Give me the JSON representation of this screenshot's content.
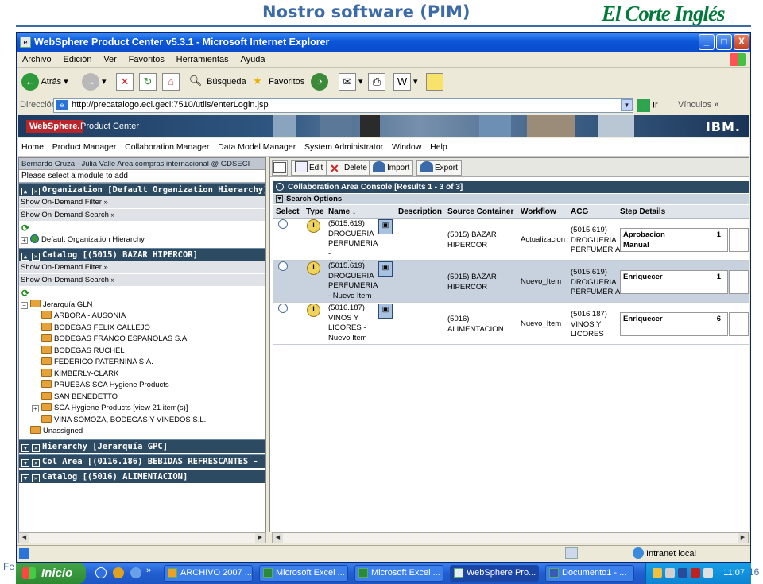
{
  "slide": {
    "title": "Nostro software (PIM)",
    "logo_text": "El Corte Inglés",
    "footer_left": "Fe",
    "page_number": "16"
  },
  "window": {
    "title": "WebSphere Product Center v5.3.1 - Microsoft Internet Explorer",
    "minimize": "_",
    "maximize": "□",
    "close": "X"
  },
  "ie_menu": [
    "Archivo",
    "Edición",
    "Ver",
    "Favoritos",
    "Herramientas",
    "Ayuda"
  ],
  "ie_toolbar": {
    "back": "Atrás",
    "search": "Búsqueda",
    "favorites": "Favoritos"
  },
  "address": {
    "label": "Dirección",
    "url": "http://precatalogo.eci.geci:7510/utils/enterLogin.jsp",
    "go": "Ir",
    "links": "Vínculos"
  },
  "banner": {
    "brand": "WebSphere.",
    "product": "Product Center",
    "vendor": "IBM."
  },
  "app_menu": [
    "Home",
    "Product Manager",
    "Collaboration Manager",
    "Data Model Manager",
    "System Administrator",
    "Window",
    "Help"
  ],
  "left": {
    "user_line": "Bernardo Cruza - Julia Valle Area compras internacional @ GDSECI",
    "module_select": "Please select a module to add",
    "org_section": "Organization [Default Organization Hierarchy]",
    "ondemand_filter": "Show On-Demand Filter »",
    "ondemand_search": "Show On-Demand Search »",
    "org_tree_root": "Default Organization Hierarchy",
    "catalog_section": "Catalog [(5015) BAZAR HIPERCOR]",
    "tree_root": "Jerarquía GLN",
    "tree_items": [
      "ARBORA - AUSONIA",
      "BODEGAS FELIX CALLEJO",
      "BODEGAS FRANCO ESPAÑOLAS S.A.",
      "BODEGAS RUCHEL",
      "FEDERICO PATERNINA S.A.",
      "KIMBERLY-CLARK",
      "PRUEBAS SCA Hygiene Products",
      "SAN BENEDETTO",
      "SCA Hygiene Products [view 21 item(s)]",
      "VIÑA SOMOZA, BODEGAS Y VIÑEDOS S.L."
    ],
    "unassigned": "Unassigned",
    "collapsed_sections": [
      "Hierarchy [Jerarquía GPC]",
      "Col Area [(0116.186) BEBIDAS REFRESCANTES -",
      "Catalog [(5016) ALIMENTACION]"
    ]
  },
  "actions": {
    "edit": "Edit",
    "delete": "Delete",
    "import": "Import",
    "export": "Export"
  },
  "console": {
    "title": "Collaboration Area Console [Results 1 - 3 of 3]",
    "search_options": "Search Options",
    "columns": {
      "select": "Select",
      "type": "Type",
      "name": "Name",
      "description": "Description",
      "source": "Source Container",
      "workflow": "Workflow",
      "acg": "ACG",
      "step": "Step Details"
    },
    "rows": [
      {
        "name": [
          "(5015.619)",
          "DROGUERIA",
          "PERFUMERIA",
          "-",
          "Actualizacion"
        ],
        "source": [
          "(5015) BAZAR",
          "HIPERCOR"
        ],
        "workflow": "Actualizacion",
        "acg": [
          "(5015.619)",
          "DROGUERIA",
          "PERFUMERIA"
        ],
        "step": [
          "Aprobacion",
          "Manual"
        ],
        "count": "1"
      },
      {
        "name": [
          "(5015.619)",
          "DROGUERIA",
          "PERFUMERIA",
          "- Nuevo Item"
        ],
        "source": [
          "(5015) BAZAR",
          "HIPERCOR"
        ],
        "workflow": "Nuevo_Item",
        "acg": [
          "(5015.619)",
          "DROGUERIA",
          "PERFUMERIA"
        ],
        "step": [
          "Enriquecer"
        ],
        "count": "1"
      },
      {
        "name": [
          "(5016.187)",
          "VINOS Y",
          "LICORES -",
          "Nuevo Item"
        ],
        "source": [
          "(5016)",
          "ALIMENTACION"
        ],
        "workflow": "Nuevo_Item",
        "acg": [
          "(5016.187)",
          "VINOS Y",
          "LICORES"
        ],
        "step": [
          "Enriquecer"
        ],
        "count": "6"
      }
    ]
  },
  "status": {
    "zone": "Intranet local"
  },
  "taskbar": {
    "start": "Inicio",
    "tasks": [
      "ARCHIVO 2007 ...",
      "Microsoft Excel ...",
      "Microsoft Excel ...",
      "WebSphere Pro...",
      "Documento1 - ..."
    ],
    "clock": "11:07"
  },
  "colors": {
    "titlebar": "#0b57d8",
    "section_header": "#2d4a63",
    "slide_accent": "#3d6ba8",
    "logo_green": "#00793a"
  }
}
